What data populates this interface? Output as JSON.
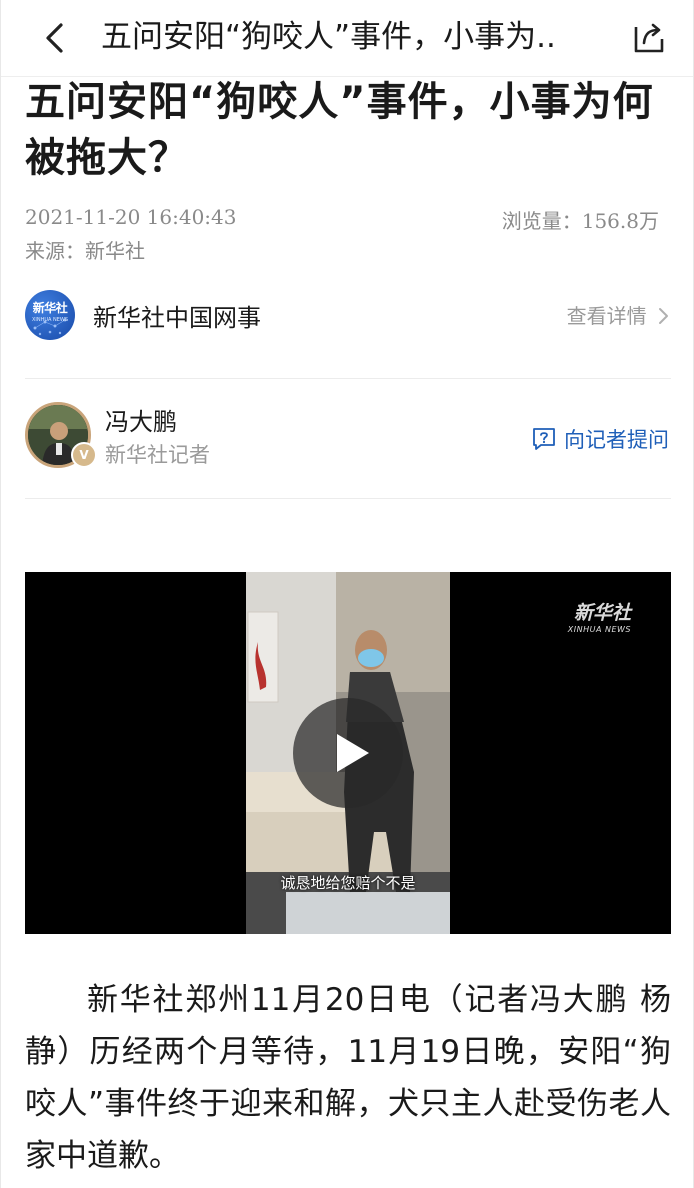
{
  "nav": {
    "title": "五问安阳“狗咬人”事件，小事为.."
  },
  "article": {
    "headline": "五问安阳“狗咬人”事件，小事为何被拖大？",
    "date": "2021-11-20 16:40:43",
    "source": "来源：新华社",
    "views_label": "浏览量：",
    "views_value": "156.8万"
  },
  "channel": {
    "logo_text": "新华社",
    "logo_sub": "XINHUA NEWS",
    "name": "新华社中国网事",
    "detail_label": "查看详情"
  },
  "author": {
    "name": "冯大鹏",
    "role": "新华社记者",
    "badge": "V",
    "ask_label": "向记者提问"
  },
  "video": {
    "watermark": "新华社",
    "watermark_sub": "XINHUA NEWS",
    "subtitle": "诚恳地给您赔个不是"
  },
  "body": {
    "paragraph1": "新华社郑州11月20日电（记者冯大鹏 杨静）历经两个月等待，11月19日晚，安阳“狗咬人”事件终于迎来和解，犬只主人赴受伤老人家中道歉。"
  },
  "icons": {
    "back": "chevron-left-icon",
    "share": "share-icon",
    "play": "play-icon",
    "question": "question-icon",
    "chevron_right": "chevron-right-icon"
  },
  "colors": {
    "link_blue": "#1f5fb8",
    "muted_gray": "#8a8a8a",
    "logo_blue": "#1849a8"
  }
}
